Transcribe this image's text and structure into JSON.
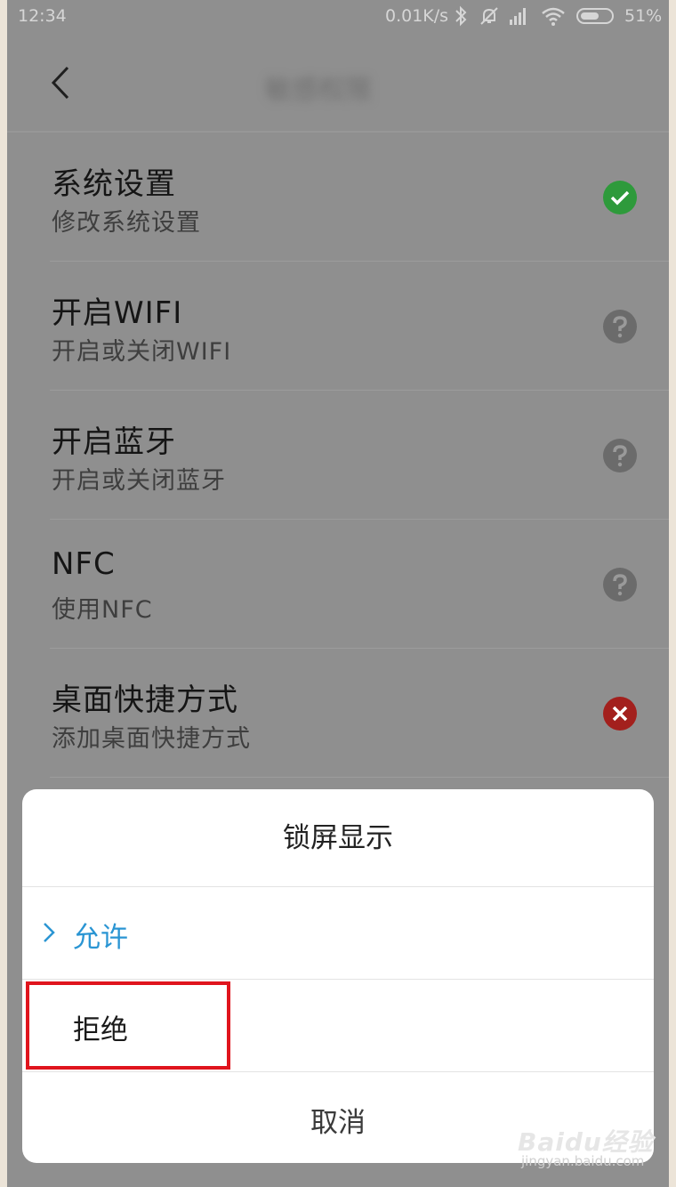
{
  "status_bar": {
    "time": "12:34",
    "network_speed": "0.01K/s",
    "battery_percent": "51%",
    "icons": [
      "bluetooth-icon",
      "mute-icon",
      "signal-icon",
      "wifi-icon",
      "battery-icon"
    ]
  },
  "app_bar": {
    "title": "敏感权限"
  },
  "permissions": [
    {
      "title": "系统设置",
      "subtitle": "修改系统设置",
      "status": "allowed",
      "status_icon": "check-icon",
      "color": "#2e9a3b"
    },
    {
      "title": "开启WIFI",
      "subtitle": "开启或关闭WIFI",
      "status": "ask",
      "status_icon": "question-icon",
      "color": "#6b6b6b"
    },
    {
      "title": "开启蓝牙",
      "subtitle": "开启或关闭蓝牙",
      "status": "ask",
      "status_icon": "question-icon",
      "color": "#6b6b6b"
    },
    {
      "title": "NFC",
      "subtitle": "使用NFC",
      "status": "ask",
      "status_icon": "question-icon",
      "color": "#6b6b6b"
    },
    {
      "title": "桌面快捷方式",
      "subtitle": "添加桌面快捷方式",
      "status": "denied",
      "status_icon": "close-icon",
      "color": "#a3201d"
    }
  ],
  "dialog": {
    "title": "锁屏显示",
    "options": [
      {
        "label": "允许",
        "selected": true
      },
      {
        "label": "拒绝",
        "selected": false
      }
    ],
    "cancel_label": "取消"
  },
  "watermark": {
    "brand": "Baidu经验",
    "url": "jingyan.baidu.com"
  },
  "colors": {
    "accent": "#2a95d3",
    "highlight": "#e0141d",
    "overlay": "#8f8f8f"
  }
}
